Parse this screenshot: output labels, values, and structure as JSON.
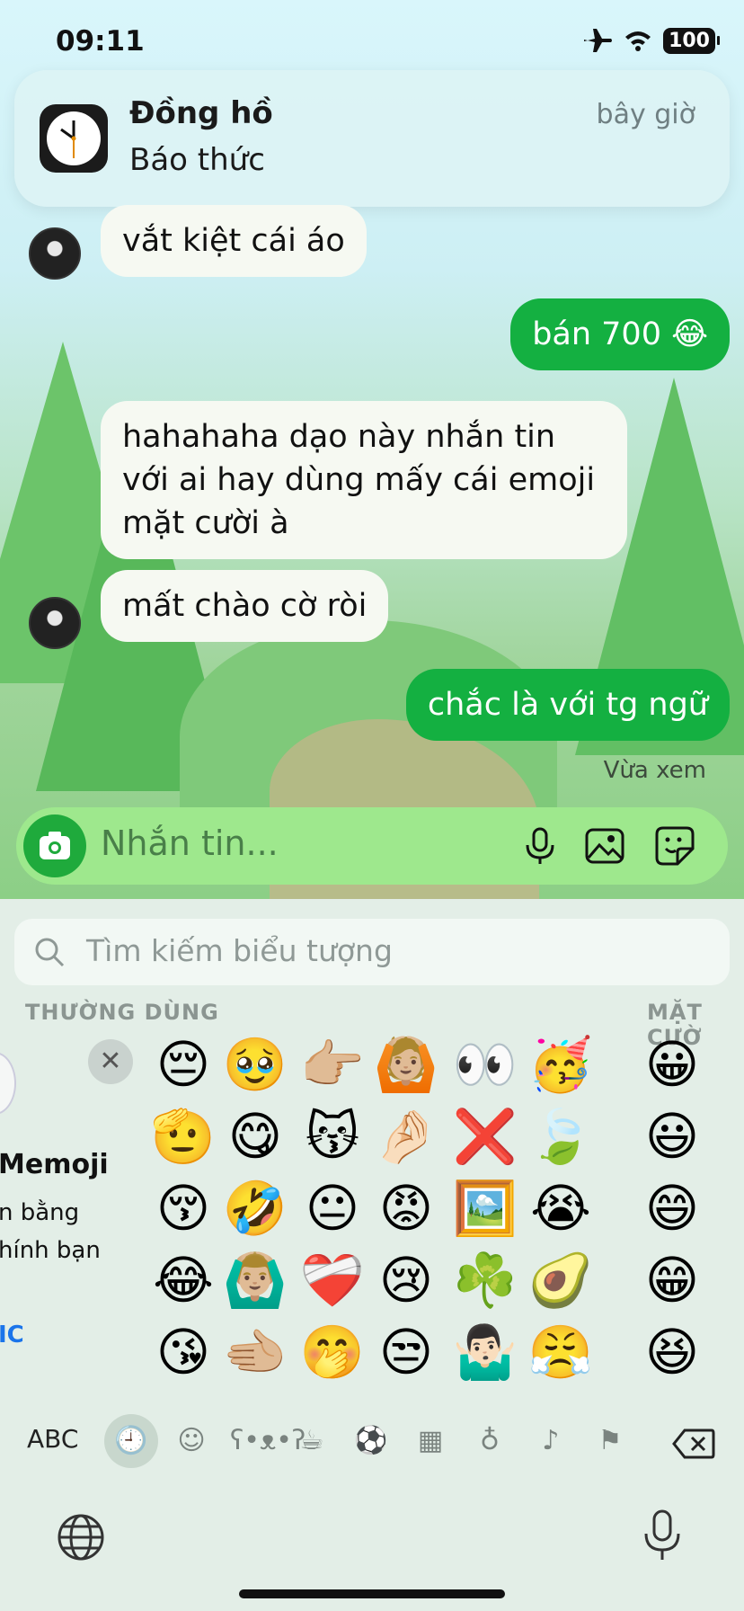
{
  "status": {
    "time": "09:11",
    "battery": "100"
  },
  "notification": {
    "app": "Đồng hồ",
    "message": "Báo thức",
    "time": "bây giờ"
  },
  "messages": [
    {
      "side": "in",
      "text": "vắt kiệt cái áo"
    },
    {
      "side": "out",
      "text": "bán 700 😂"
    },
    {
      "side": "in",
      "text": "hahahaha dạo này nhắn tin với ai hay dùng mấy cái emoji mặt cười à"
    },
    {
      "side": "in",
      "text": "mất chào cờ ròi"
    },
    {
      "side": "out",
      "text": "chắc là với tg ngữ"
    }
  ],
  "seen_label": "Vừa xem",
  "composer": {
    "placeholder": "Nhắn tin..."
  },
  "keyboard": {
    "search_placeholder": "Tìm kiếm biểu tượng",
    "section_frequent": "THƯỜNG DÙNG",
    "section_smileys": "MẶT CƯỜ",
    "memoji": {
      "title": "Memoji",
      "line1": "n bằng",
      "line2": "hính bạn",
      "link": "IC"
    },
    "frequent_emojis": [
      [
        "😔",
        "🥹",
        "👉🏼",
        "🙆🏼",
        "👀",
        "🥳"
      ],
      [
        "🫡",
        "😋",
        "😽",
        "🤌🏻",
        "❌",
        "🍃"
      ],
      [
        "😚",
        "🤣",
        "😐",
        "😡",
        "🖼️",
        "😭"
      ],
      [
        "😂",
        "🙆🏼‍♂️",
        "❤️‍🩹",
        "😢",
        "☘️",
        "🥑"
      ],
      [
        "😘",
        "🫲🏼",
        "🤭",
        "😒",
        "🤷🏻‍♂️",
        "😤"
      ]
    ],
    "smiley_emojis": [
      "😀",
      "😃",
      "😄",
      "😁",
      "😆"
    ],
    "abc_label": "ABC",
    "categories": [
      "clock-icon",
      "smiley-icon",
      "animal-icon",
      "food-icon",
      "ball-icon",
      "building-icon",
      "bulb-icon",
      "symbols-icon",
      "flag-icon"
    ]
  }
}
